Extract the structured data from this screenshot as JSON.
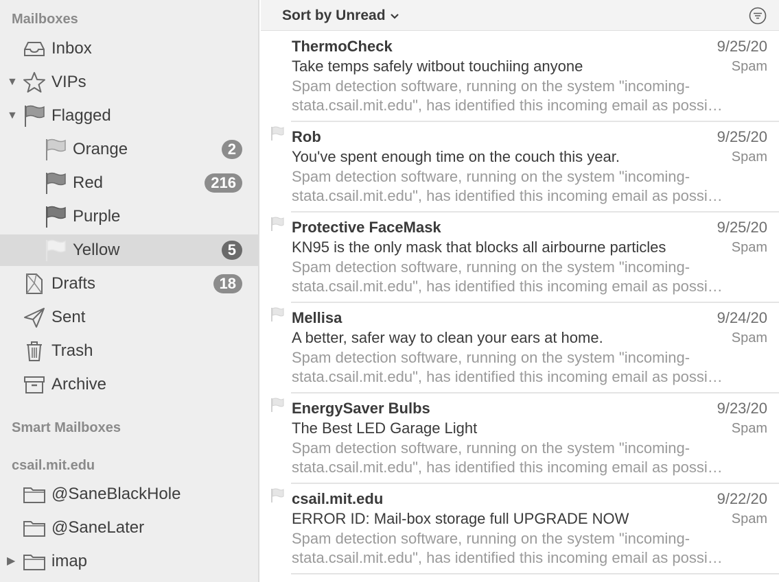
{
  "sidebar": {
    "mailboxes_header": "Mailboxes",
    "items": [
      {
        "label": "Inbox",
        "icon": "inbox-icon"
      },
      {
        "label": "VIPs",
        "icon": "star-icon"
      },
      {
        "label": "Flagged",
        "icon": "flag-icon"
      },
      {
        "label": "Orange",
        "icon": "flag-icon",
        "badge": "2"
      },
      {
        "label": "Red",
        "icon": "flag-icon",
        "badge": "216"
      },
      {
        "label": "Purple",
        "icon": "flag-icon"
      },
      {
        "label": "Yellow",
        "icon": "flag-icon",
        "badge": "5",
        "selected": true
      },
      {
        "label": "Drafts",
        "icon": "draft-icon",
        "badge": "18"
      },
      {
        "label": "Sent",
        "icon": "paperplane-icon"
      },
      {
        "label": "Trash",
        "icon": "trash-icon"
      },
      {
        "label": "Archive",
        "icon": "archive-icon"
      }
    ],
    "smart_header": "Smart Mailboxes",
    "account_header": "csail.mit.edu",
    "account_items": [
      {
        "label": "@SaneBlackHole",
        "icon": "folder-icon"
      },
      {
        "label": "@SaneLater",
        "icon": "folder-icon"
      },
      {
        "label": "imap",
        "icon": "folder-icon"
      }
    ]
  },
  "list": {
    "sort_label": "Sort by Unread",
    "messages": [
      {
        "sender": "ThermoCheck",
        "date": "9/25/20",
        "subject": "Take temps safely witbout touchiing anyone",
        "mailbox": "Spam",
        "preview": "Spam detection software, running on the system \"incoming-stata.csail.mit.edu\", has identified this incoming email as possi…",
        "flagged": false
      },
      {
        "sender": "Rob",
        "date": "9/25/20",
        "subject": "You've spent enough time on the couch this year.",
        "mailbox": "Spam",
        "preview": "Spam detection software, running on the system \"incoming-stata.csail.mit.edu\", has identified this incoming email as possi…",
        "flagged": true
      },
      {
        "sender": "Protective FaceMask",
        "date": "9/25/20",
        "subject": "KN95 is the only mask that blocks all airbourne particles",
        "mailbox": "Spam",
        "preview": "Spam detection software, running on the system \"incoming-stata.csail.mit.edu\", has identified this incoming email as possi…",
        "flagged": true
      },
      {
        "sender": "Mellisa",
        "date": "9/24/20",
        "subject": "A better, safer way to clean your ears at home.",
        "mailbox": "Spam",
        "preview": "Spam detection software, running on the system \"incoming-stata.csail.mit.edu\", has identified this incoming email as possi…",
        "flagged": true
      },
      {
        "sender": "EnergySaver Bulbs",
        "date": "9/23/20",
        "subject": "The Best LED Garage Light",
        "mailbox": "Spam",
        "preview": "Spam detection software, running on the system \"incoming-stata.csail.mit.edu\", has identified this incoming email as possi…",
        "flagged": true
      },
      {
        "sender": "csail.mit.edu",
        "date": "9/22/20",
        "subject": "ERROR ID: Mail-box storage full UPGRADE NOW",
        "mailbox": "Spam",
        "preview": "Spam detection software, running on the system \"incoming-stata.csail.mit.edu\", has identified this incoming email as possi…",
        "flagged": true
      }
    ]
  },
  "colors": {
    "sidebar_bg": "#eeeeee",
    "selected_row": "#dadada",
    "badge_bg": "#8c8c8c",
    "preview_text": "#9a9a9a"
  }
}
